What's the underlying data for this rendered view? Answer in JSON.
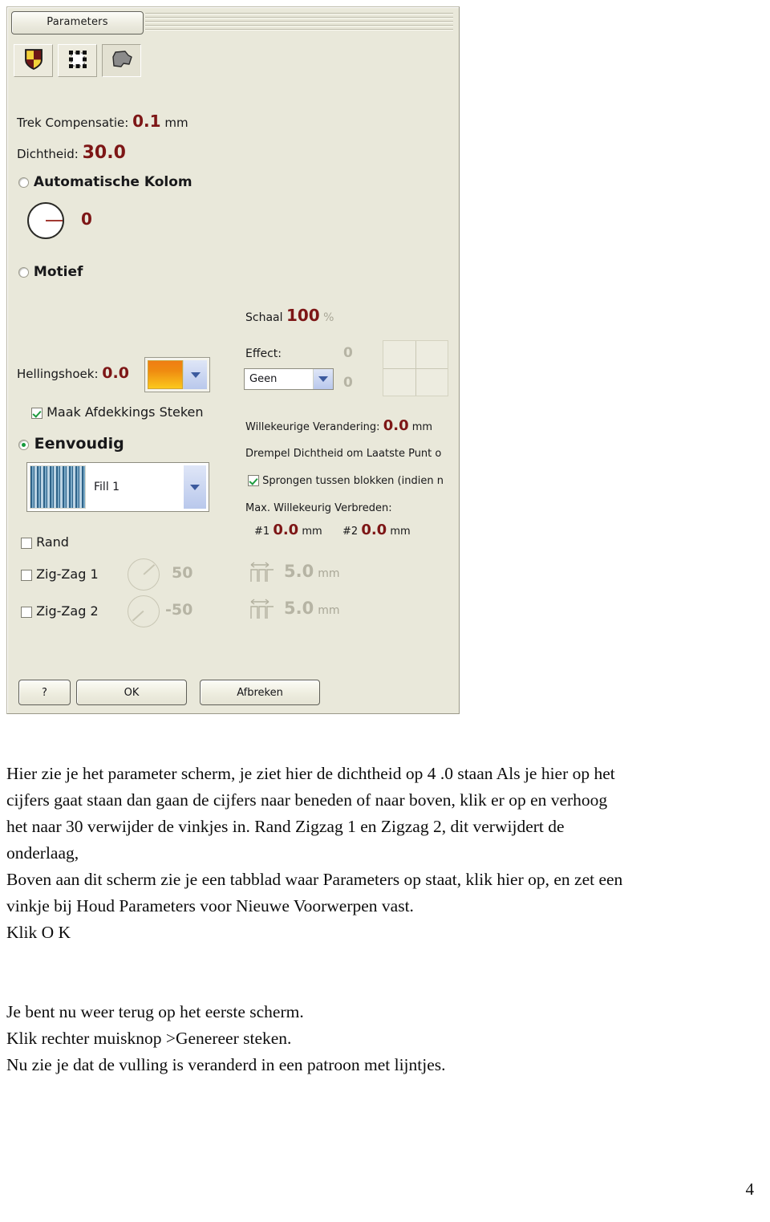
{
  "dialog": {
    "tab": {
      "label": "Parameters"
    },
    "toolbar": [
      {
        "name": "shield-icon",
        "title": "Shield"
      },
      {
        "name": "selection-box-icon",
        "title": "Selection"
      },
      {
        "name": "filled-shape-icon",
        "title": "Shape"
      }
    ],
    "fields": {
      "trek_compensatie_label": "Trek Compensatie:",
      "trek_compensatie_value": "0.1",
      "trek_compensatie_unit": "mm",
      "dichtheid_label": "Dichtheid:",
      "dichtheid_value": "30.0",
      "automatische_kolom_label": "Automatische Kolom",
      "angle_dial_value": "0",
      "motief_label": "Motief",
      "schaal_label": "Schaal",
      "schaal_value": "100",
      "schaal_unit": "%",
      "effect_label": "Effect:",
      "effect_value": "Geen",
      "effect_param_1": "0",
      "effect_param_2": "0",
      "hellingshoek_label": "Hellingshoek:",
      "hellingshoek_value": "0.0",
      "maak_afdekkings_steken_label": "Maak Afdekkings Steken",
      "eenvoudig_label": "Eenvoudig",
      "fill_label": "Fill 1",
      "rand_label": "Rand",
      "zigzag1_label": "Zig-Zag 1",
      "zigzag1_angle": "50",
      "zigzag1_width": "5.0",
      "zigzag1_unit": "mm",
      "zigzag2_label": "Zig-Zag 2",
      "zigzag2_angle": "-50",
      "zigzag2_width": "5.0",
      "zigzag2_unit": "mm",
      "willekeurige_verandering_label": "Willekeurige Verandering:",
      "willekeurige_verandering_value": "0.0",
      "willekeurige_verandering_unit": "mm",
      "drempel_dichtheid_label": "Drempel Dichtheid om Laatste Punt o",
      "sprongen_label": "Sprongen tussen blokken (indien n",
      "max_willekeurig_label": "Max. Willekeurig Verbreden:",
      "max_1_label": "#1",
      "max_1_value": "0.0",
      "max_1_unit": "mm",
      "max_2_label": "#2",
      "max_2_value": "0.0",
      "max_2_unit": "mm"
    },
    "states": {
      "automatische_kolom_checked": false,
      "motief_checked": false,
      "eenvoudig_checked": true,
      "maak_afdekkings_steken_checked": true,
      "sprongen_checked": true,
      "rand_checked": false,
      "zigzag1_checked": false,
      "zigzag2_checked": false
    },
    "buttons": {
      "help_label": "?",
      "ok_label": "OK",
      "cancel_label": "Afbreken"
    },
    "colors": {
      "dialog_background": "#e9e8da",
      "value_red": "#7d1616",
      "disabled_grey": "#b6b4a4",
      "swatch_gradient_from": "#f07d13",
      "swatch_gradient_to": "#fbc81c",
      "fill_pattern_blue": "#2e6389",
      "check_green": "#1e9b3e"
    }
  },
  "prose": {
    "para1_line1": "Hier zie je het parameter scherm, je ziet hier de dichtheid op 4 .0 staan  Als je hier op het",
    "para1_line2": "cijfers gaat staan dan gaan de cijfers naar beneden of naar boven, klik er op en verhoog",
    "para1_line3": "het naar 30 verwijder de vinkjes in. Rand  Zigzag 1 en  Zigzag 2, dit verwijdert de",
    "para1_line4": "onderlaag,",
    "para2_line1": "Boven aan dit scherm zie je een tabblad waar Parameters op staat, klik hier op, en zet een",
    "para2_line2": "vinkje bij Houd Parameters voor Nieuwe Voorwerpen vast.",
    "para2_line3": "Klik O K",
    "para3_line1": "Je bent nu weer terug op het eerste scherm.",
    "para3_line2": "Klik rechter muisknop >Genereer steken.",
    "para3_line3": "Nu zie je dat de vulling is veranderd in een patroon met lijntjes."
  },
  "page_number": "4"
}
